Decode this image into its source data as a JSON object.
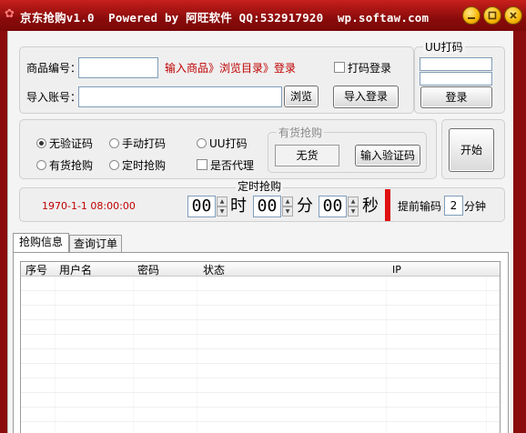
{
  "window": {
    "title": "京东抢购v1.0  Powered by 阿旺软件 QQ:532917920  wp.softaw.com"
  },
  "product": {
    "label": "商品编号：",
    "value": "",
    "hint": "输入商品》浏览目录》登录",
    "captcha_check": "打码登录"
  },
  "account": {
    "label": "导入账号：",
    "value": "",
    "browse_btn": "浏览",
    "import_btn": "导入登录"
  },
  "uu_panel": {
    "title": "UU打码",
    "user": "",
    "pass": "",
    "login_btn": "登录"
  },
  "modes": {
    "no_captcha": "无验证码",
    "manual_captcha": "手动打码",
    "uu_captcha": "UU打码",
    "in_stock": "有货抢购",
    "timed": "定时抢购",
    "proxy": "是否代理",
    "selected": "no_captcha"
  },
  "stock_panel": {
    "title": "有货抢购",
    "no_stock_btn": "无货",
    "enter_captcha_btn": "输入验证码"
  },
  "start_btn": "开始",
  "timer": {
    "title": "定时抢购",
    "clock": "1970-1-1 08:00:00",
    "hour": "00",
    "hour_unit": "时",
    "minute": "00",
    "minute_unit": "分",
    "second": "00",
    "second_unit": "秒",
    "advance_label": "提前输码",
    "advance_value": "2",
    "advance_unit": "分钟"
  },
  "tabs": [
    "抢购信息",
    "查询订单"
  ],
  "table": {
    "columns": [
      "序号",
      "用户名",
      "密码",
      "状态",
      "IP"
    ]
  },
  "colors": {
    "titlebar": "#8a0b0b",
    "accent_red": "#c00000"
  }
}
